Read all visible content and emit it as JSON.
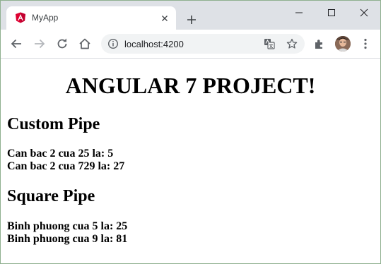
{
  "browser": {
    "tab_title": "MyApp",
    "url": "localhost:4200"
  },
  "page": {
    "title": "ANGULAR 7 PROJECT!",
    "custom_pipe": {
      "heading": "Custom Pipe",
      "lines": [
        "Can bac 2 cua 25 la: 5",
        "Can bac 2 cua 729 la: 27"
      ]
    },
    "square_pipe": {
      "heading": "Square Pipe",
      "lines": [
        "Binh phuong cua 5 la: 25",
        "Binh phuong cua 9 la: 81"
      ]
    }
  },
  "colors": {
    "angular_red": "#dd0031",
    "titlebar": "#dee1e6",
    "omnibox": "#f1f3f4"
  },
  "icons": [
    "angular-logo-icon",
    "close-icon",
    "plus-icon",
    "minimize-icon",
    "maximize-icon",
    "back-icon",
    "forward-icon",
    "reload-icon",
    "home-icon",
    "info-icon",
    "translate-icon",
    "star-icon",
    "extensions-icon",
    "more-icon"
  ]
}
